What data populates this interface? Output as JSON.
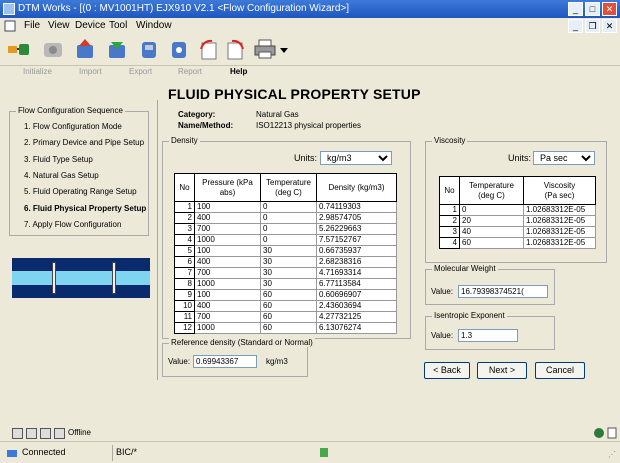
{
  "window": {
    "title": "DTM Works - [(0 : MV1001HT) EJX910 V2.1 <Flow Configuration Wizard>]",
    "min": "_",
    "max": "□",
    "close": "✕"
  },
  "menu": {
    "file": "File",
    "view": "View",
    "device": "Device",
    "tool": "Tool",
    "window": "Window"
  },
  "toolbar_labels": [
    "Initialize",
    "Import",
    "Export",
    "Report",
    "Help"
  ],
  "page_title": "FLUID PHYSICAL PROPERTY SETUP",
  "category_label": "Category:",
  "category_value": "Natural Gas",
  "name_method_label": "Name/Method:",
  "name_method_value": "ISO12213 physical properties",
  "sequence": {
    "caption": "Flow Configuration Sequence",
    "items": [
      "1. Flow Configuration Mode",
      "2. Primary Device and Pipe Setup",
      "3. Fluid Type Setup",
      "4. Natural Gas Setup",
      "5. Fluid Operating Range Setup",
      "6. Fluid Physical Property Setup",
      "7. Apply Flow Configuration"
    ]
  },
  "density": {
    "caption": "Density",
    "units_label": "Units:",
    "units_value": "kg/m3",
    "headers": [
      "No",
      "Pressure (kPa abs)",
      "Temperature\n(deg C)",
      "Density (kg/m3)"
    ],
    "rows": [
      [
        "1",
        "100",
        "0",
        "0.74119303"
      ],
      [
        "2",
        "400",
        "0",
        "2.98574705"
      ],
      [
        "3",
        "700",
        "0",
        "5.26229663"
      ],
      [
        "4",
        "1000",
        "0",
        "7.57152767"
      ],
      [
        "5",
        "100",
        "30",
        "0.66735937"
      ],
      [
        "6",
        "400",
        "30",
        "2.68238316"
      ],
      [
        "7",
        "700",
        "30",
        "4.71693314"
      ],
      [
        "8",
        "1000",
        "30",
        "6.77113584"
      ],
      [
        "9",
        "100",
        "60",
        "0.60696907"
      ],
      [
        "10",
        "400",
        "60",
        "2.43603694"
      ],
      [
        "11",
        "700",
        "60",
        "4.27732125"
      ],
      [
        "12",
        "1000",
        "60",
        "6.13076274"
      ]
    ]
  },
  "reference_density": {
    "caption": "Reference density (Standard or Normal)",
    "value_label": "Value:",
    "value": "0.69943367",
    "unit": "kg/m3"
  },
  "viscosity": {
    "caption": "Viscosity",
    "units_label": "Units:",
    "units_value": "Pa sec",
    "headers": [
      "No",
      "Temperature\n(deg C)",
      "Viscosity\n(Pa sec)"
    ],
    "rows": [
      [
        "1",
        "0",
        "1.02683312E-05"
      ],
      [
        "2",
        "20",
        "1.02683312E-05"
      ],
      [
        "3",
        "40",
        "1.02683312E-05"
      ],
      [
        "4",
        "60",
        "1.02683312E-05"
      ]
    ]
  },
  "molecular_weight": {
    "caption": "Molecular Weight",
    "value_label": "Value:",
    "value": "16.79398374521("
  },
  "isentropic": {
    "caption": "Isentropic Exponent",
    "value_label": "Value:",
    "value": "1.3"
  },
  "buttons": {
    "back": "< Back",
    "next": "Next >",
    "cancel": "Cancel"
  },
  "status": {
    "offline": "Offline",
    "connected": "Connected",
    "bic": "BIC/*"
  }
}
